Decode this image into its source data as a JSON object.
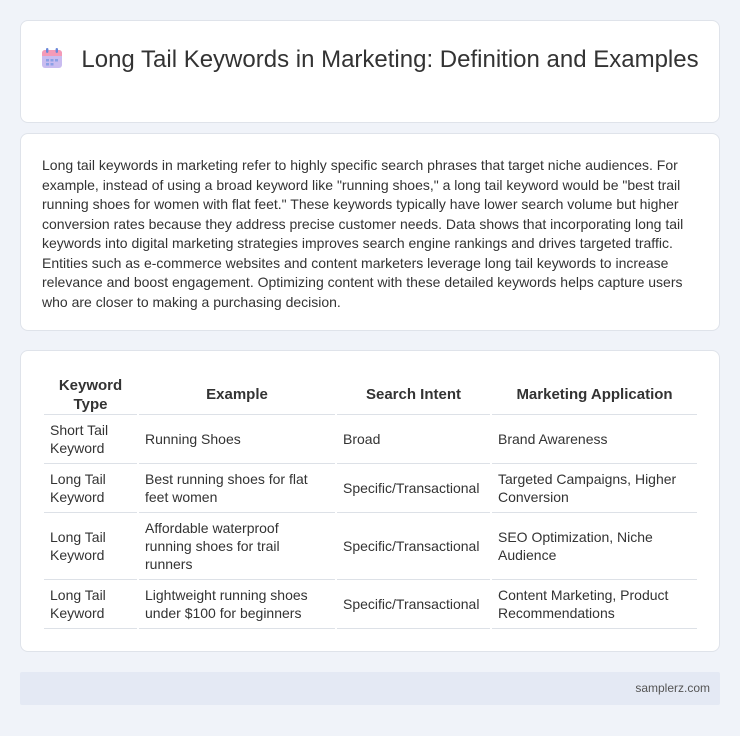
{
  "header": {
    "title": "Long Tail Keywords in Marketing: Definition and Examples",
    "icon": "calendar-icon",
    "icon_colors": {
      "body": "#c7b8ef",
      "rings": "#6a86d8",
      "top": "#f28fb0"
    }
  },
  "intro": {
    "text": "Long tail keywords in marketing refer to highly specific search phrases that target niche audiences. For example, instead of using a broad keyword like \"running shoes,\" a long tail keyword would be \"best trail running shoes for women with flat feet.\" These keywords typically have lower search volume but higher conversion rates because they address precise customer needs. Data shows that incorporating long tail keywords into digital marketing strategies improves search engine rankings and drives targeted traffic. Entities such as e-commerce websites and content marketers leverage long tail keywords to increase relevance and boost engagement. Optimizing content with these detailed keywords helps capture users who are closer to making a purchasing decision."
  },
  "table": {
    "headers": [
      "Keyword Type",
      "Example",
      "Search Intent",
      "Marketing Application"
    ],
    "rows": [
      [
        "Short Tail Keyword",
        "Running Shoes",
        "Broad",
        "Brand Awareness"
      ],
      [
        "Long Tail Keyword",
        "Best running shoes for flat feet women",
        "Specific/Transactional",
        "Targeted Campaigns, Higher Conversion"
      ],
      [
        "Long Tail Keyword",
        "Affordable waterproof running shoes for trail runners",
        "Specific/Transactional",
        "SEO Optimization, Niche Audience"
      ],
      [
        "Long Tail Keyword",
        "Lightweight running shoes under $100 for beginners",
        "Specific/Transactional",
        "Content Marketing, Product Recommendations"
      ]
    ]
  },
  "footer": {
    "site": "samplerz.com"
  }
}
